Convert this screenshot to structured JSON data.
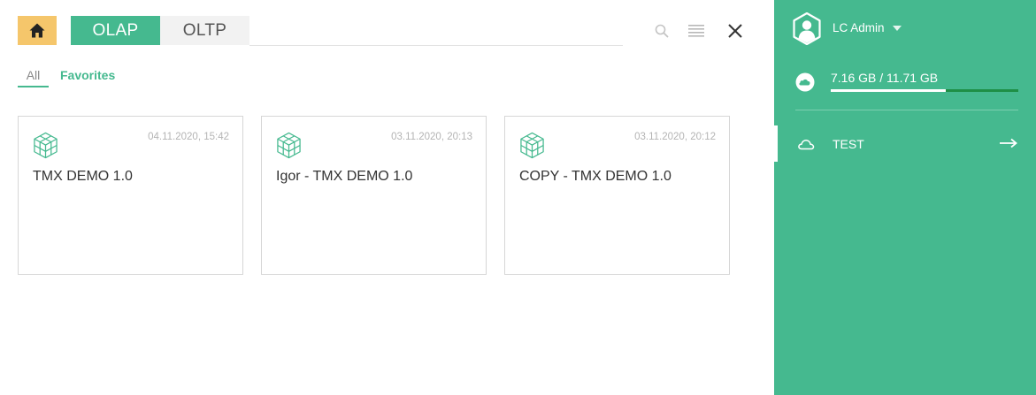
{
  "header": {
    "home_icon": "home-icon",
    "tabs": [
      {
        "label": "OLAP",
        "active": true
      },
      {
        "label": "OLTP",
        "active": false
      }
    ],
    "icons": [
      "search-icon",
      "list-icon",
      "close-icon"
    ]
  },
  "filters": {
    "all_label": "All",
    "favorites_label": "Favorites",
    "active": "All"
  },
  "cards": [
    {
      "date": "04.11.2020, 15:42",
      "title": "TMX DEMO 1.0",
      "icon": "cube-icon"
    },
    {
      "date": "03.11.2020, 20:13",
      "title": "Igor - TMX DEMO 1.0",
      "icon": "cube-icon"
    },
    {
      "date": "03.11.2020, 20:12",
      "title": "COPY - TMX DEMO 1.0",
      "icon": "cube-icon"
    }
  ],
  "sidebar": {
    "user": {
      "name": "LC Admin",
      "icon": "user-avatar-icon"
    },
    "storage": {
      "text": "7.16 GB / 11.71 GB",
      "used_fraction": 0.611,
      "icon": "cloud-filled-icon"
    },
    "items": [
      {
        "label": "TEST",
        "icon": "cloud-outline-icon",
        "action_icon": "arrow-right-icon"
      }
    ]
  },
  "colors": {
    "accent": "#45b98f",
    "home": "#f5c66b",
    "storage_track": "#1e8f46"
  }
}
